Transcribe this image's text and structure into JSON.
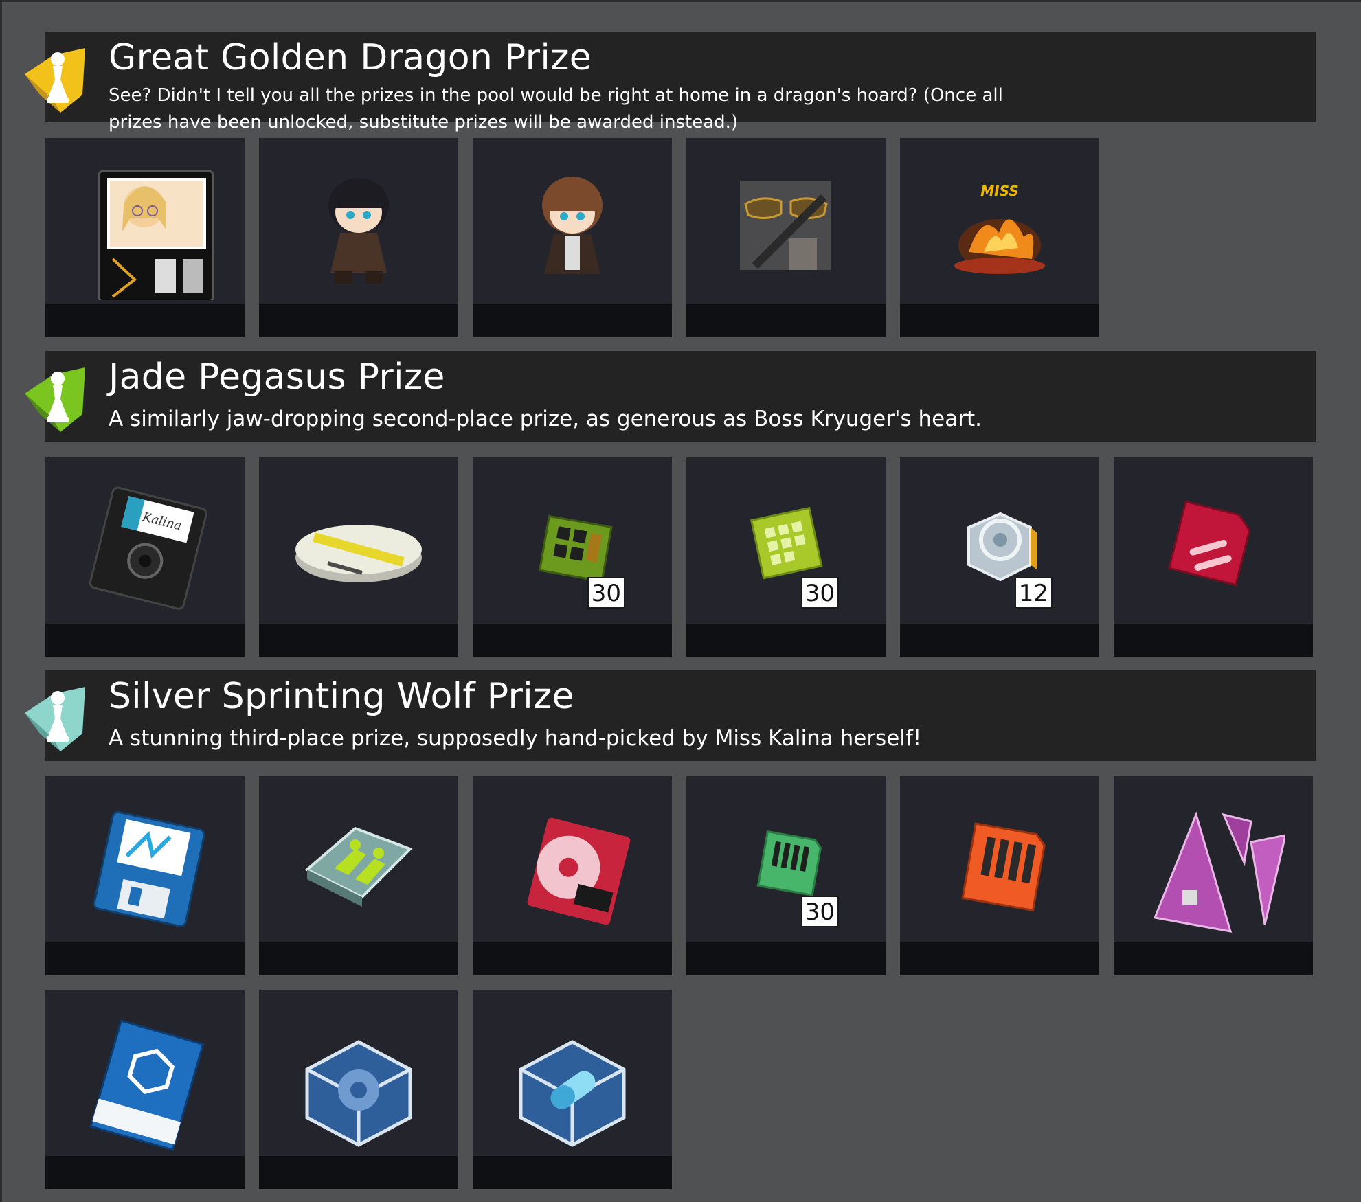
{
  "tiers": [
    {
      "title": "Great Golden Dragon Prize",
      "description": "See? Didn't I tell you all the prizes in the pool would be right at home in a dragon's hoard? (Once all prizes have been unlocked, substitute prizes will be awarded instead.)",
      "badge_color": "#f2c21b",
      "badge_icon": "chess-pawn-icon",
      "items": [
        {
          "icon": "profile-card-icon"
        },
        {
          "icon": "chibi-officer-black-hair-icon"
        },
        {
          "icon": "chibi-officer-brown-hair-icon"
        },
        {
          "icon": "sunglasses-costume-icon"
        },
        {
          "icon": "miss-explosion-effect-icon"
        }
      ]
    },
    {
      "title": "Jade Pegasus Prize",
      "description": "A similarly jaw-dropping second-place prize, as generous as Boss Kryuger's heart.",
      "badge_color": "#7ac51f",
      "badge_icon": "chess-pawn-icon",
      "items": [
        {
          "icon": "black-floppy-disk-icon"
        },
        {
          "icon": "data-disc-icon"
        },
        {
          "icon": "green-chip-icon",
          "quantity": "30"
        },
        {
          "icon": "lime-chip-icon",
          "quantity": "30"
        },
        {
          "icon": "core-cube-icon",
          "quantity": "12"
        },
        {
          "icon": "red-card-icon"
        }
      ]
    },
    {
      "title": "Silver Sprinting Wolf Prize",
      "description": "A stunning third-place prize, supposedly hand-picked by Miss Kalina herself!",
      "badge_color": "#8ed6cc",
      "badge_icon": "chess-pawn-icon",
      "items": [
        {
          "icon": "blue-floppy-disk-icon"
        },
        {
          "icon": "training-tile-icon"
        },
        {
          "icon": "minidisc-icon"
        },
        {
          "icon": "green-memory-card-icon",
          "quantity": "30"
        },
        {
          "icon": "orange-memory-card-icon"
        },
        {
          "icon": "purple-shards-icon"
        },
        {
          "icon": "blue-manual-icon"
        },
        {
          "icon": "gear-cube-icon"
        },
        {
          "icon": "capsule-cube-icon"
        }
      ]
    }
  ]
}
